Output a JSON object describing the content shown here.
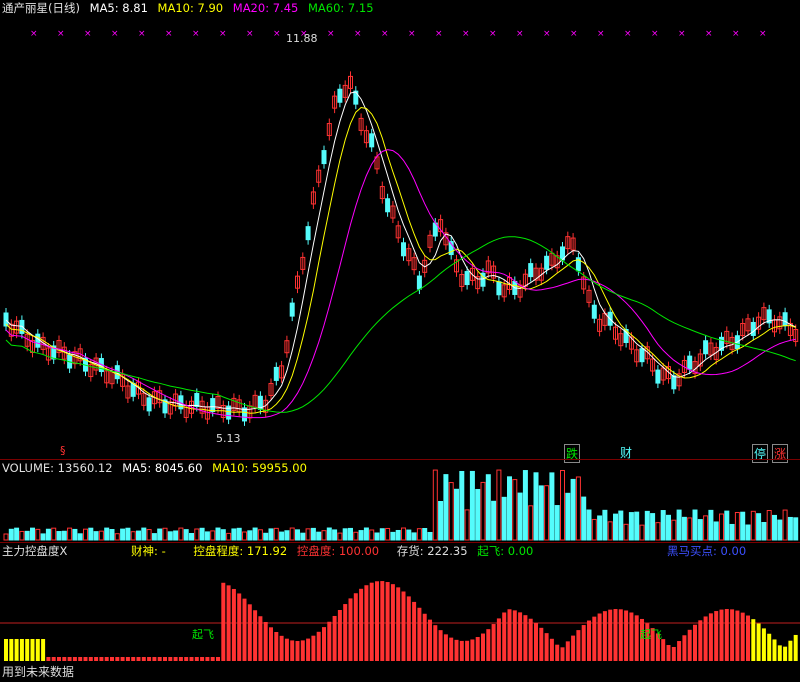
{
  "main": {
    "title": "通产丽星(日线)",
    "ma5_label": "MA5: 8.81",
    "ma10_label": "MA10: 7.90",
    "ma20_label": "MA20: 7.45",
    "ma60_label": "MA60: 7.15",
    "high_label": "11.88",
    "low_label": "5.13",
    "signals": {
      "die": "跌",
      "cai": "财",
      "ting": "停",
      "zhang": "涨",
      "s": "§"
    }
  },
  "volume": {
    "title": "VOLUME: 13560.12",
    "ma5_label": "MA5: 8045.60",
    "ma10_label": "MA10: 59955.00"
  },
  "indicator": {
    "title": "主力控盘度X",
    "caishen": "财神: -",
    "kongpan_degree": "控盘程度: 171.92",
    "kongpan": "控盘度: 100.00",
    "cunhuo": "存货: 222.35",
    "qifei": "起飞: 0.00",
    "buy_point": "黑马买点: 0.00",
    "qifei_marker": "起飞",
    "footer": "用到未来数据"
  },
  "colors": {
    "up": "#ff3232",
    "down": "#54fcfc",
    "ma5": "#ffffff",
    "ma10": "#ffff00",
    "ma20": "#ff00ff",
    "ma60": "#00e600"
  }
}
